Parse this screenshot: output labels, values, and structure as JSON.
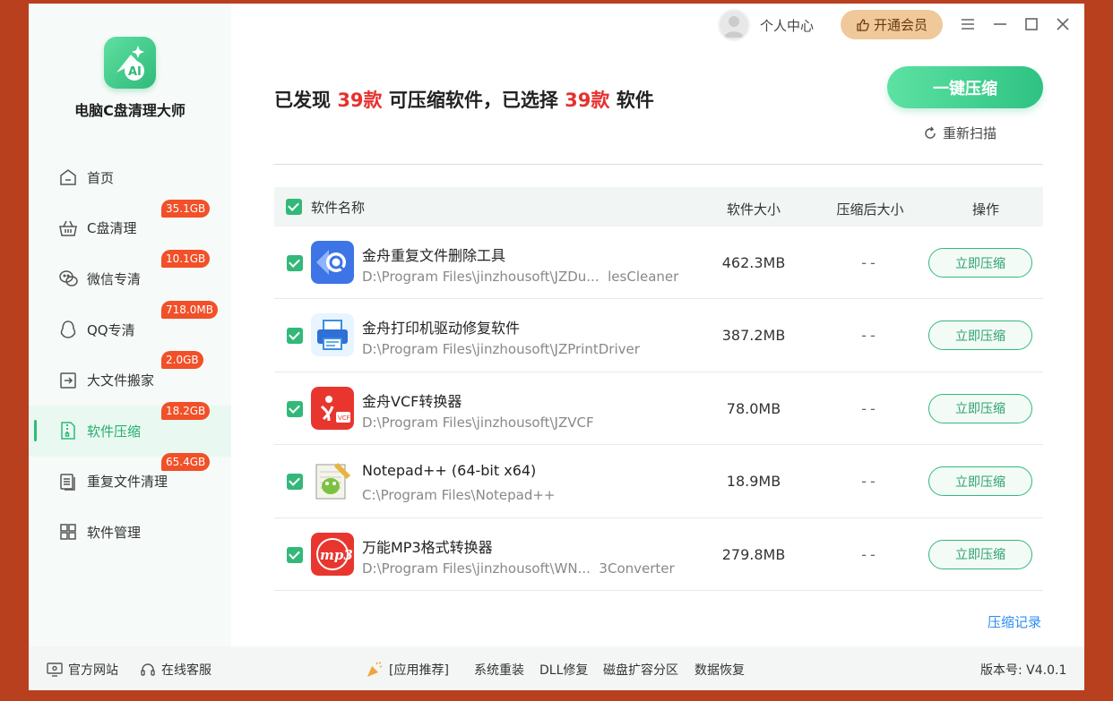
{
  "app": {
    "name": "电脑C盘清理大师",
    "version_label": "版本号: V4.0.1"
  },
  "topbar": {
    "user_center": "个人中心",
    "vip_button": "开通会员"
  },
  "sidebar": {
    "items": [
      {
        "label": "首页",
        "badge": ""
      },
      {
        "label": "C盘清理",
        "badge": "35.1GB"
      },
      {
        "label": "微信专清",
        "badge": "10.1GB"
      },
      {
        "label": "QQ专清",
        "badge": "718.0MB"
      },
      {
        "label": "大文件搬家",
        "badge": "2.0GB"
      },
      {
        "label": "软件压缩",
        "badge": "18.2GB"
      },
      {
        "label": "重复文件清理",
        "badge": "65.4GB"
      },
      {
        "label": "软件管理",
        "badge": ""
      }
    ]
  },
  "header": {
    "prefix": "已发现 ",
    "found_count": "39款",
    "middle": " 可压缩软件，已选择 ",
    "selected_count": "39款",
    "suffix": " 软件",
    "compress_all": "一键压缩",
    "rescan": "重新扫描"
  },
  "table": {
    "headers": {
      "name": "软件名称",
      "size": "软件大小",
      "after": "压缩后大小",
      "op": "操作"
    },
    "rows": [
      {
        "name": "金舟重复文件删除工具",
        "path": "D:\\Program Files\\jinzhousoft\\JZDu...  lesCleaner",
        "size": "462.3MB",
        "after": "--",
        "op": "立即压缩",
        "icon": "duplicate-cleaner-icon"
      },
      {
        "name": "金舟打印机驱动修复软件",
        "path": "D:\\Program Files\\jinzhousoft\\JZPrintDriver",
        "size": "387.2MB",
        "after": "--",
        "op": "立即压缩",
        "icon": "printer-icon"
      },
      {
        "name": "金舟VCF转换器",
        "path": "D:\\Program Files\\jinzhousoft\\JZVCF",
        "size": "78.0MB",
        "after": "--",
        "op": "立即压缩",
        "icon": "vcf-converter-icon"
      },
      {
        "name": "Notepad++ (64-bit x64)",
        "path": "C:\\Program Files\\Notepad++",
        "size": "18.9MB",
        "after": "--",
        "op": "立即压缩",
        "icon": "notepadpp-icon"
      },
      {
        "name": "万能MP3格式转换器",
        "path": "D:\\Program Files\\jinzhousoft\\WN...  3Converter",
        "size": "279.8MB",
        "after": "--",
        "op": "立即压缩",
        "icon": "mp3-converter-icon"
      }
    ]
  },
  "history_link": "压缩记录",
  "footer": {
    "website": "官方网站",
    "support": "在线客服",
    "recommend": "[应用推荐]",
    "links": [
      "系统重装",
      "DLL修复",
      "磁盘扩容分区",
      "数据恢复"
    ]
  },
  "colors": {
    "accent": "#2fba79",
    "badge": "#f15028",
    "highlight": "#e6312f",
    "link": "#2c8ef0"
  }
}
